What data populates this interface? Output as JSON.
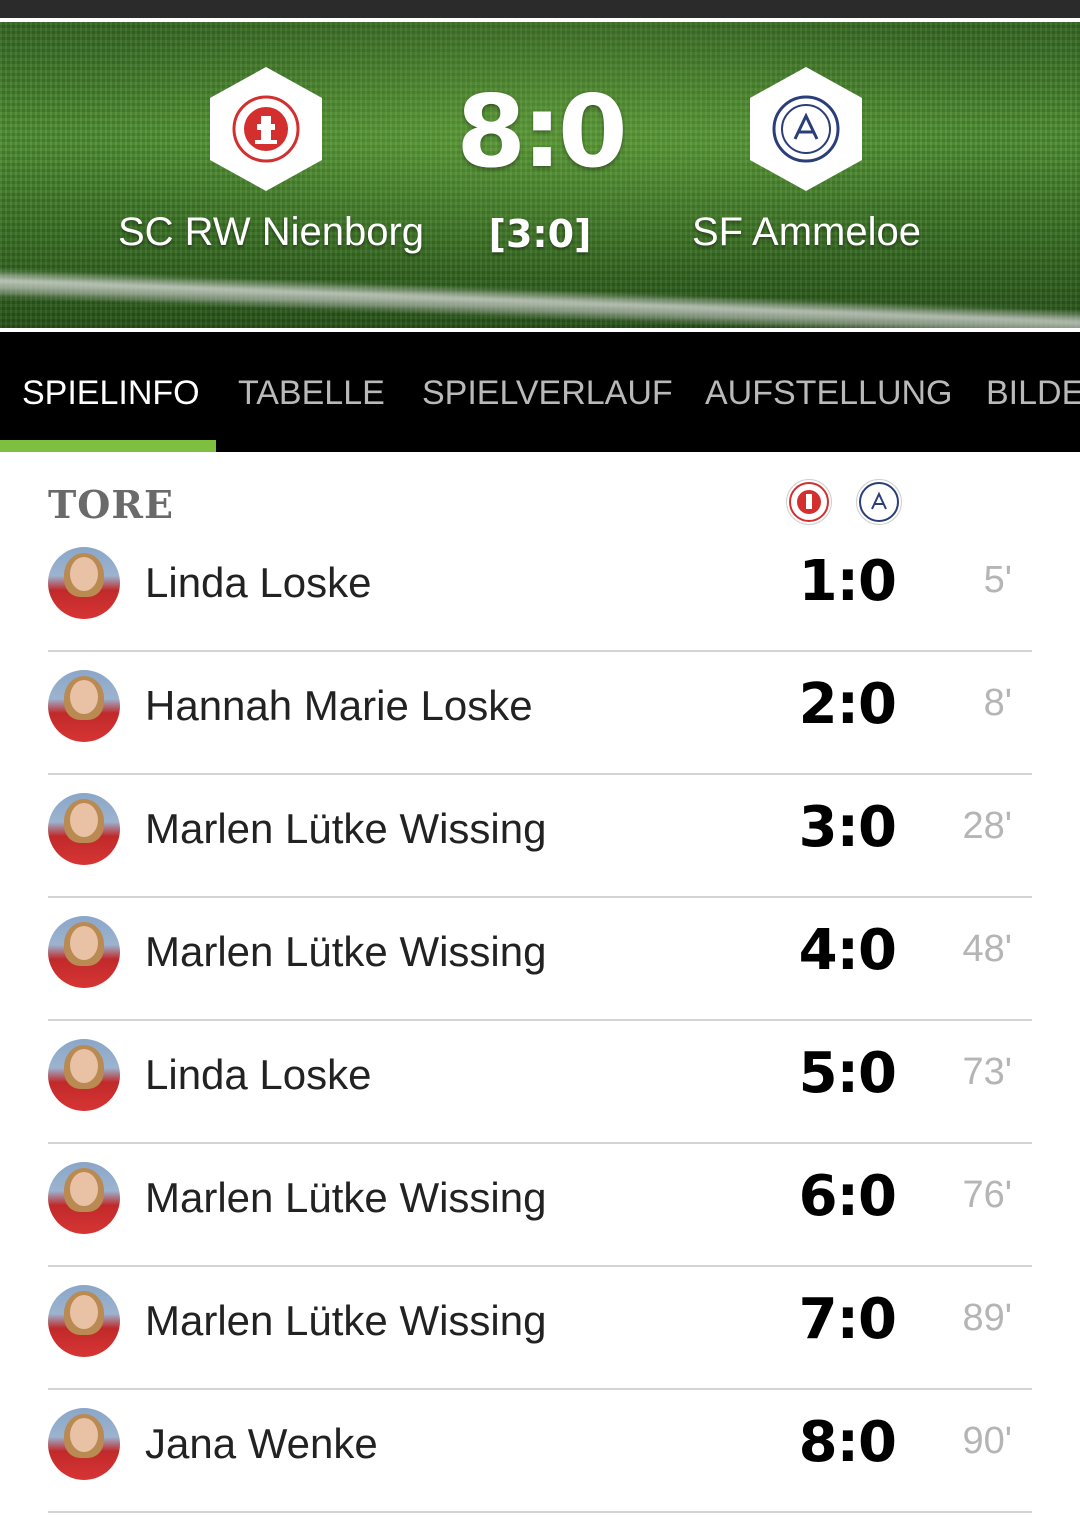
{
  "match": {
    "home_team": "SC RW Nienborg",
    "away_team": "SF Ammeloe",
    "score": "8:0",
    "halftime": "[3:0]",
    "home_logo_icon": "sc-rw-nienborg-crest-icon",
    "away_logo_icon": "sf-ammeloe-crest-icon"
  },
  "tabs": [
    {
      "label": "SPIELINFO",
      "active": true
    },
    {
      "label": "TABELLE",
      "active": false
    },
    {
      "label": "SPIELVERLAUF",
      "active": false
    },
    {
      "label": "AUFSTELLUNG",
      "active": false
    },
    {
      "label": "BILDE",
      "active": false
    }
  ],
  "goals_section": {
    "title": "TORE",
    "goals": [
      {
        "player": "Linda Loske",
        "score": "1:0",
        "minute": "5'"
      },
      {
        "player": "Hannah Marie Loske",
        "score": "2:0",
        "minute": "8'"
      },
      {
        "player": "Marlen Lütke Wissing",
        "score": "3:0",
        "minute": "28'"
      },
      {
        "player": "Marlen Lütke Wissing",
        "score": "4:0",
        "minute": "48'"
      },
      {
        "player": "Linda Loske",
        "score": "5:0",
        "minute": "73'"
      },
      {
        "player": "Marlen Lütke Wissing",
        "score": "6:0",
        "minute": "76'"
      },
      {
        "player": "Marlen Lütke Wissing",
        "score": "7:0",
        "minute": "89'"
      },
      {
        "player": "Jana Wenke",
        "score": "8:0",
        "minute": "90'"
      }
    ]
  },
  "colors": {
    "accent": "#7fbf3f",
    "tab_bar": "#000000",
    "home_red": "#d32f2f",
    "away_navy": "#2a3f7a"
  }
}
